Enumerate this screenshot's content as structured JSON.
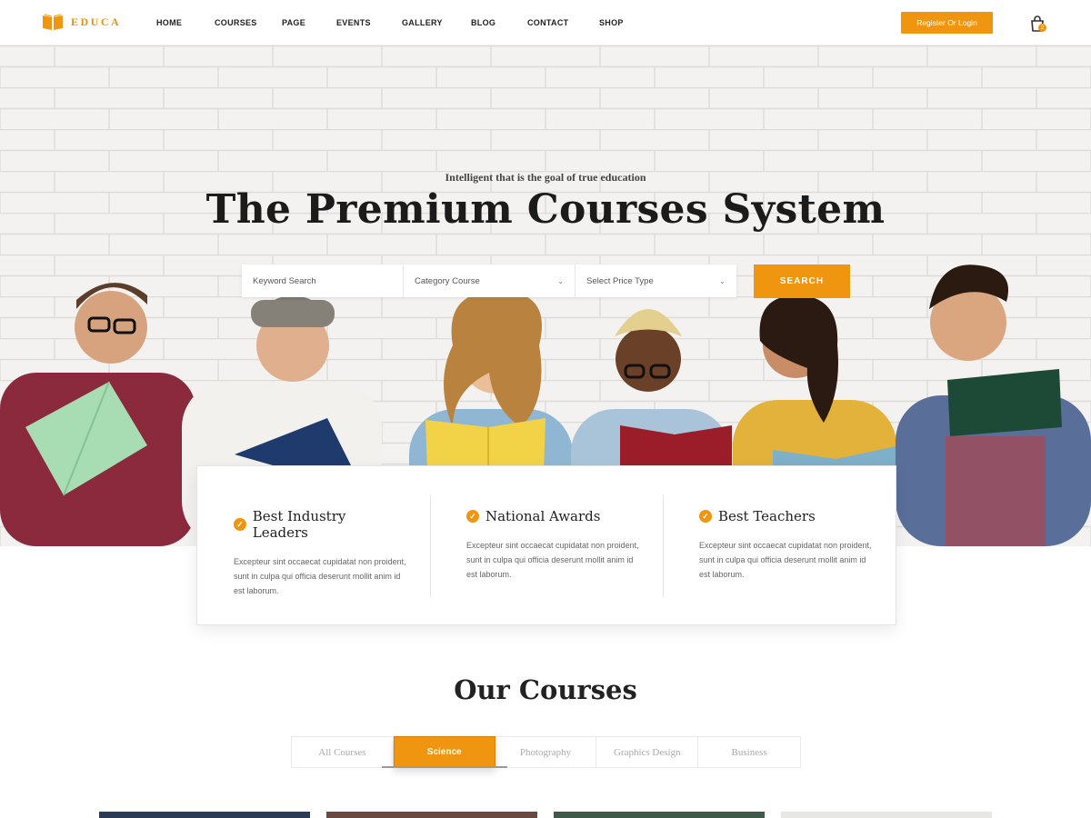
{
  "brand": {
    "name": "EDUCA",
    "accent": "#f09510"
  },
  "nav": {
    "items": [
      "HOME",
      "COURSES",
      "PAGE",
      "EVENTS",
      "GALLERY",
      "BLOG",
      "CONTACT",
      "SHOP"
    ]
  },
  "header": {
    "register_label": "Register Or Login",
    "cart_count": "2"
  },
  "hero": {
    "tagline": "Intelligent that is the goal of true education",
    "title": "The Premium Courses System"
  },
  "search": {
    "keyword_placeholder": "Keyword Search",
    "category_label": "Category Course",
    "price_label": "Select Price Type",
    "button_label": "SEARCH"
  },
  "features": [
    {
      "title": "Best Industry Leaders",
      "text": "Excepteur sint occaecat cupidatat non proident, sunt in culpa qui officia deserunt mollit anim id est laborum."
    },
    {
      "title": "National Awards",
      "text": "Excepteur sint occaecat cupidatat non proident, sunt in culpa qui officia deserunt mollit anim id est laborum."
    },
    {
      "title": "Best Teachers",
      "text": "Excepteur sint occaecat cupidatat non proident, sunt in culpa qui officia deserunt mollit anim id est laborum."
    }
  ],
  "courses": {
    "title": "Our Courses",
    "tabs": [
      "All Courses",
      "Science",
      "Photography",
      "Graphics Design",
      "Business"
    ],
    "active_tab": "Science"
  },
  "icons": {
    "logo": "book-icon",
    "cart": "shopping-bag-icon",
    "check": "check-circle-icon",
    "caret": "chevron-down-icon"
  }
}
